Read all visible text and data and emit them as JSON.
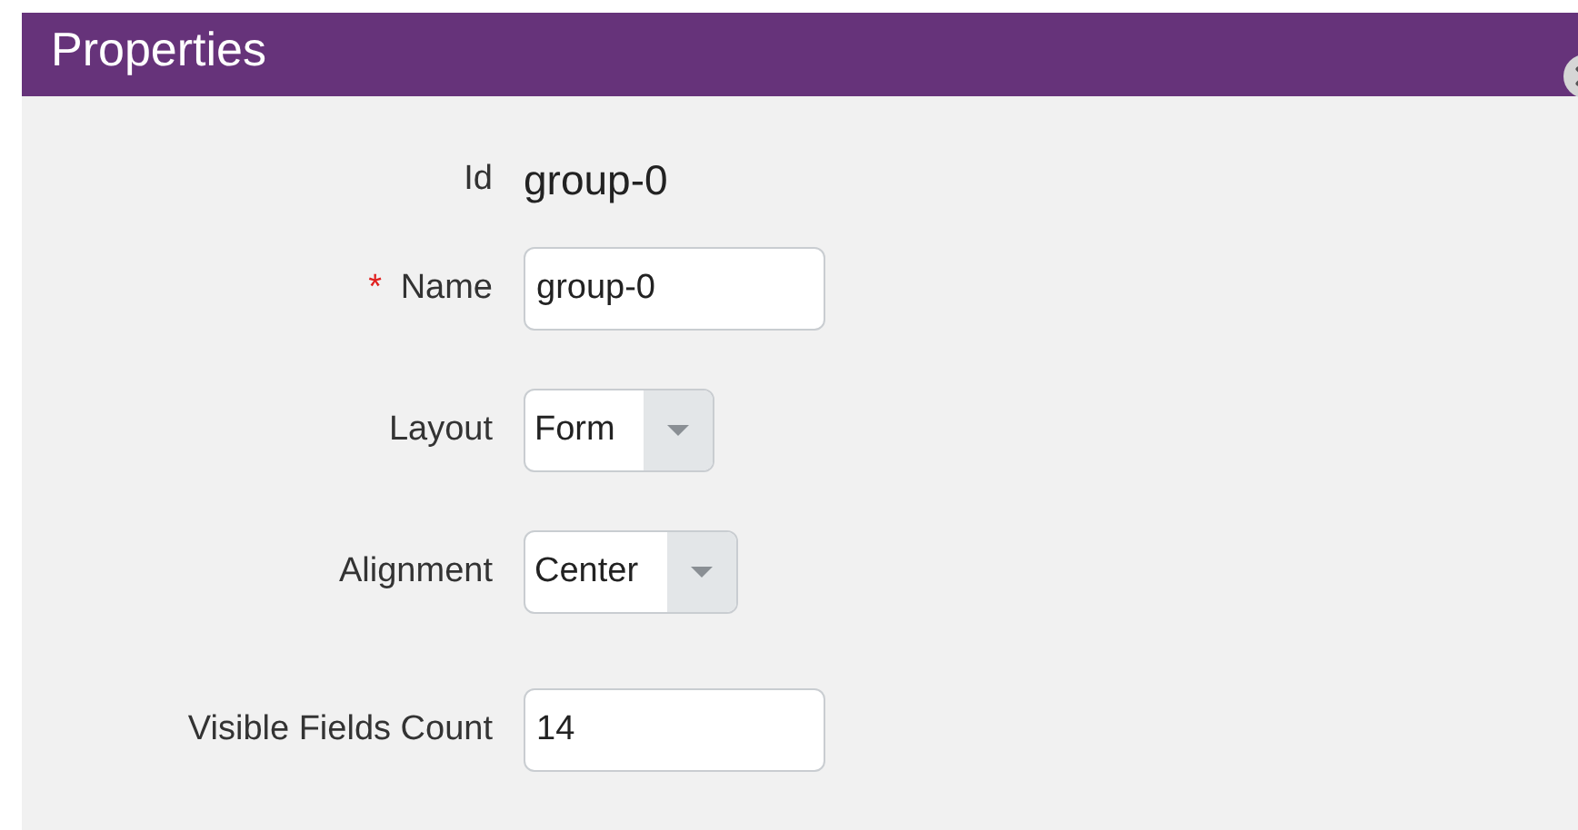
{
  "panel": {
    "title": "Properties"
  },
  "fields": [
    {
      "kind": "static",
      "label": "Id",
      "value": "group-0"
    },
    {
      "kind": "input",
      "label": "Name",
      "required_mark": "*",
      "value": "group-0"
    },
    {
      "kind": "select",
      "label": "Layout",
      "value": "Form"
    },
    {
      "kind": "select",
      "label": "Alignment",
      "value": "Center"
    },
    {
      "kind": "input",
      "label": "Visible Fields Count",
      "value": "14"
    }
  ]
}
